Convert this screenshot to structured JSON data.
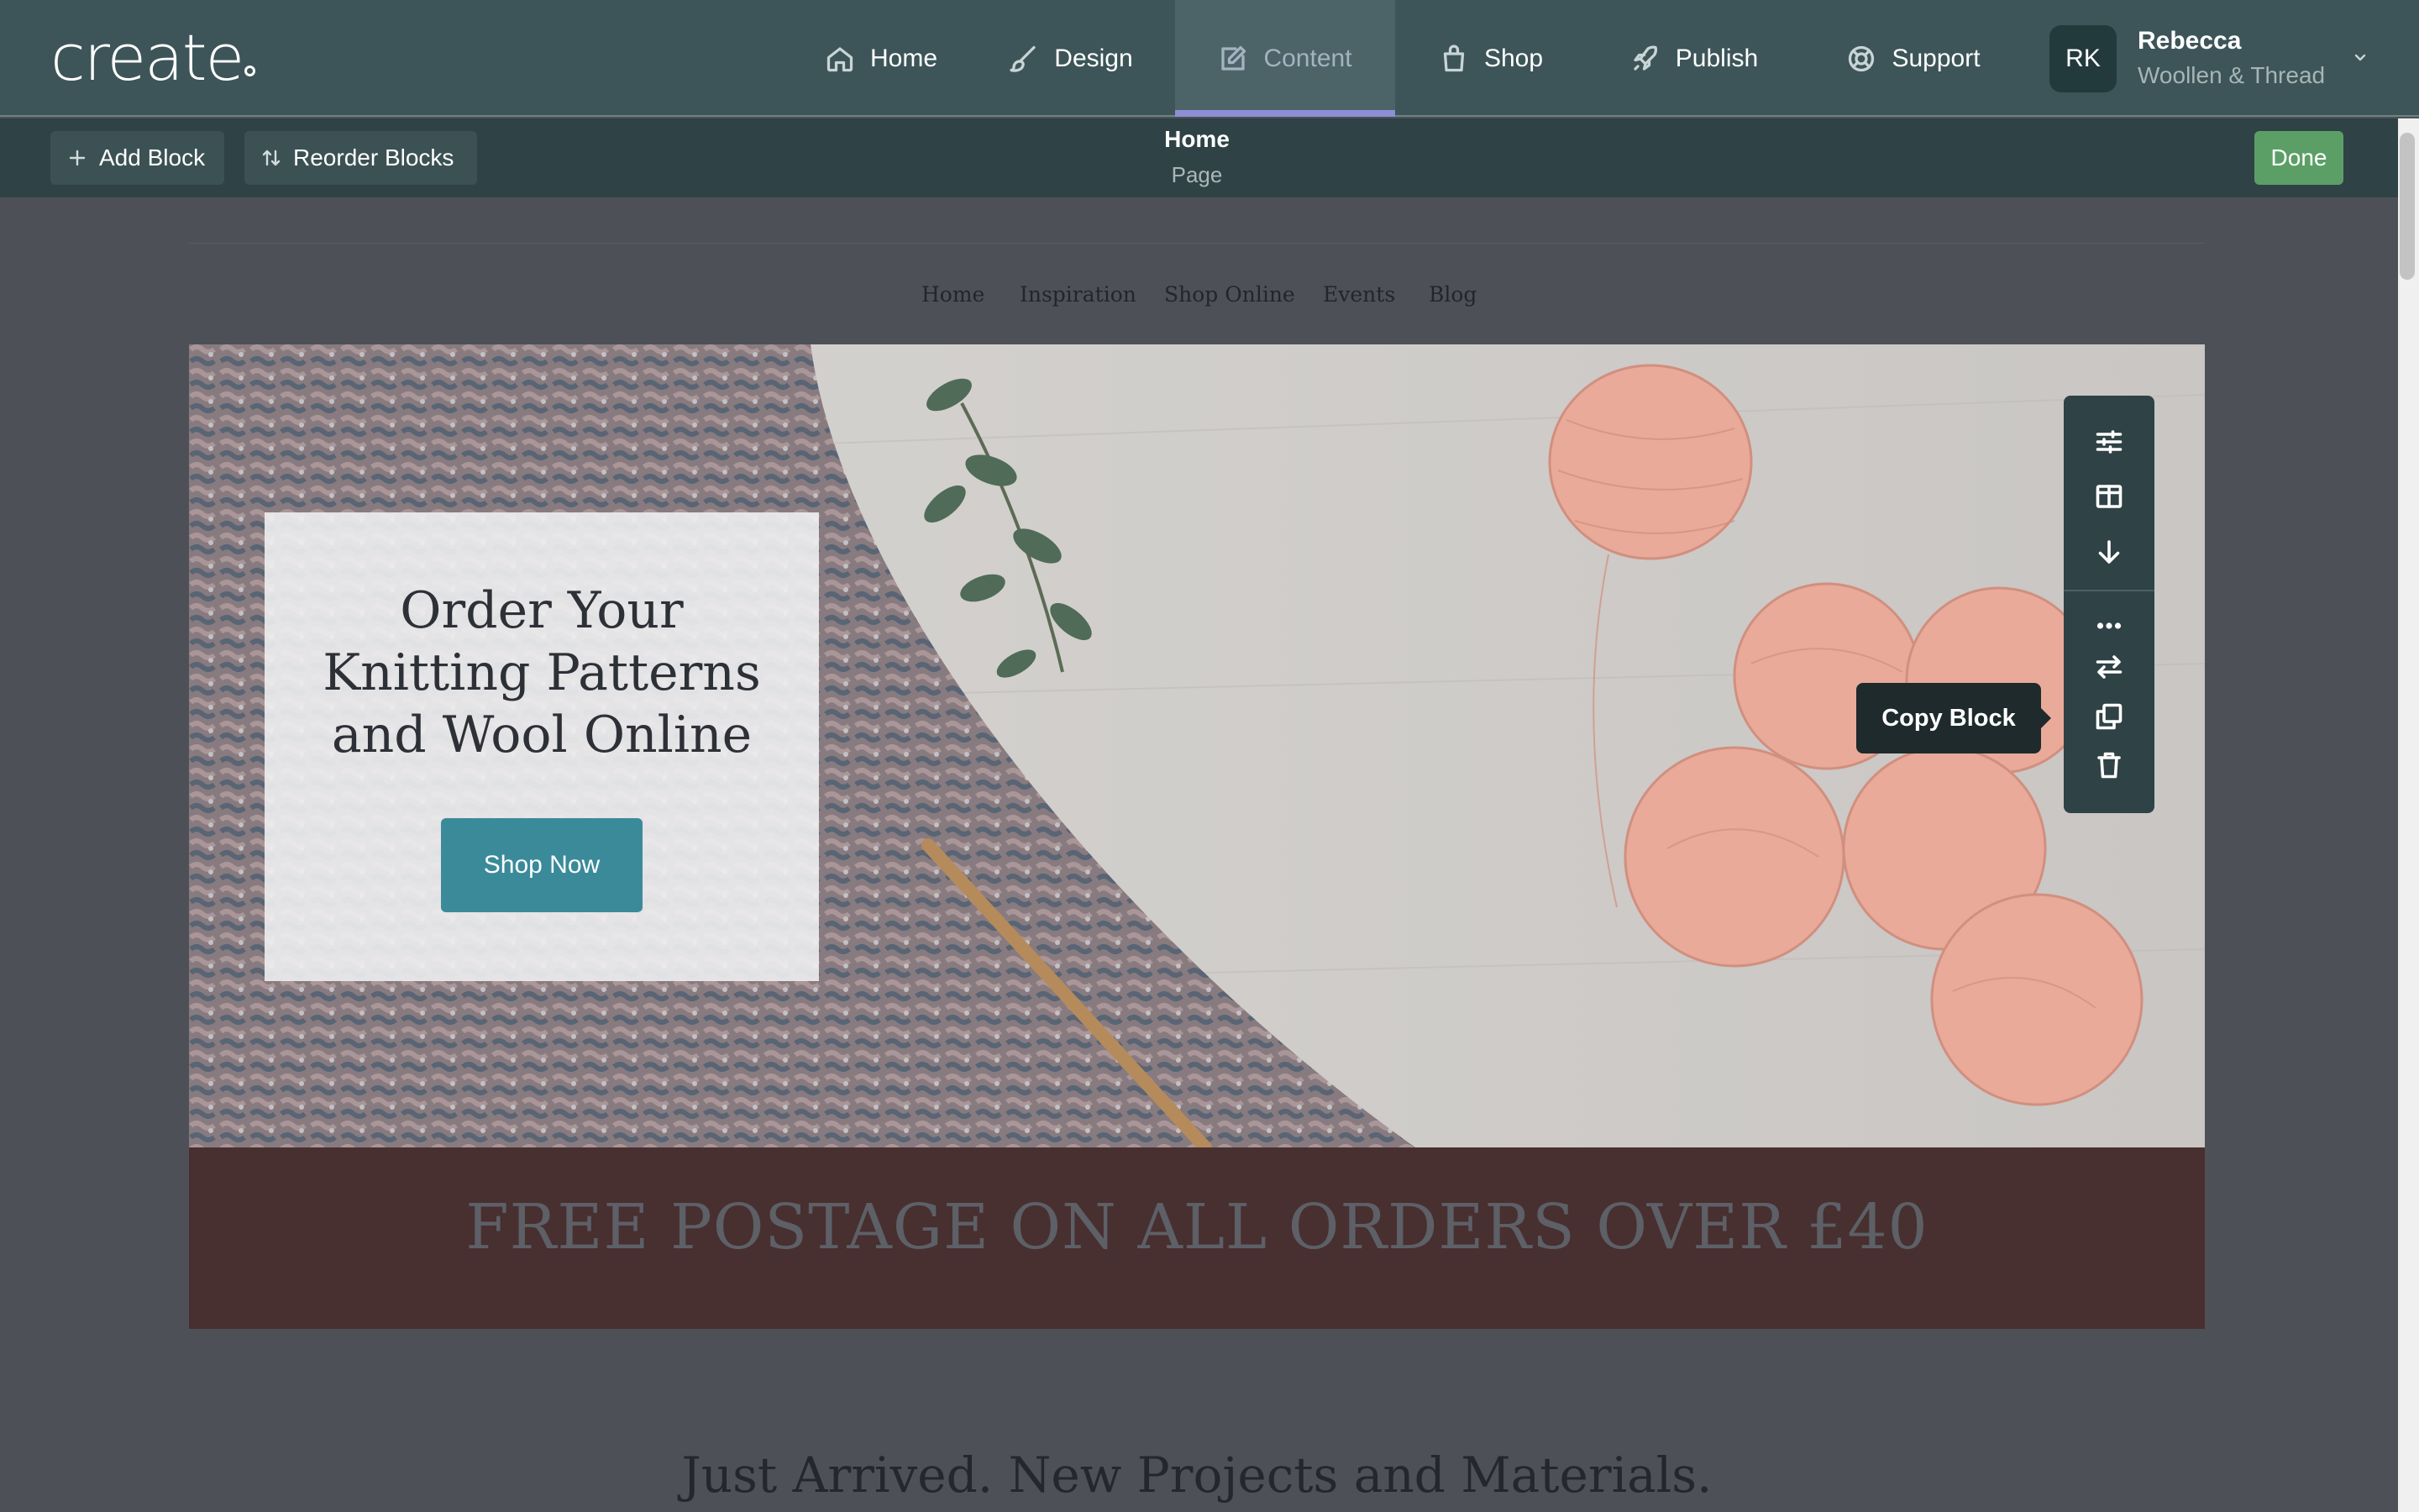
{
  "app": {
    "logo": "create"
  },
  "nav": {
    "home": "Home",
    "design": "Design",
    "content": "Content",
    "shop": "Shop",
    "publish": "Publish",
    "support": "Support"
  },
  "user": {
    "initials": "RK",
    "name": "Rebecca",
    "org": "Woollen & Thread"
  },
  "editbar": {
    "add_block": "Add Block",
    "reorder_blocks": "Reorder Blocks",
    "page_title": "Home",
    "page_type": "Page",
    "done": "Done"
  },
  "site": {
    "nav": [
      "Home",
      "Inspiration",
      "Shop Online",
      "Events",
      "Blog"
    ],
    "hero_heading_lines": [
      "Order Your",
      "Knitting Patterns",
      "and Wool Online"
    ],
    "hero_button": "Shop Now",
    "promo": "FREE POSTAGE ON ALL ORDERS OVER £40",
    "section_heading": "Just Arrived. New Projects and Materials."
  },
  "block_toolbar": {
    "icons": [
      "sliders-icon",
      "layout-icon",
      "arrow-down-icon",
      "more-icon",
      "swap-icon",
      "copy-icon",
      "trash-icon"
    ],
    "tooltip": "Copy Block"
  },
  "colors": {
    "header": "#3d5558",
    "editbar": "#2f4245",
    "done": "#5c9f66",
    "button": "#3a8a9a",
    "promo": "#482f30",
    "active_underline": "#8d8fd4"
  }
}
